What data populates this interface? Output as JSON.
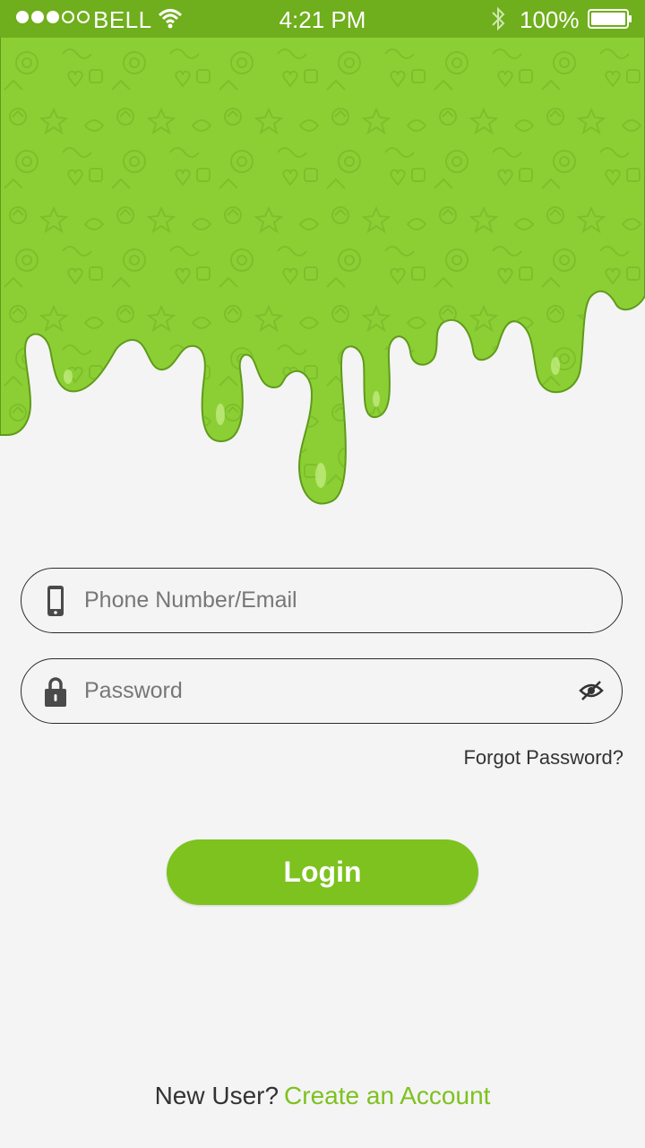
{
  "status_bar": {
    "carrier": "BELL",
    "time": "4:21 PM",
    "battery": "100%",
    "signal_bars_filled": 3,
    "signal_bars_total": 5
  },
  "header": {
    "illustration": "green-slime-doodle-pattern"
  },
  "form": {
    "phone_placeholder": "Phone Number/Email",
    "password_placeholder": "Password",
    "forgot_label": "Forgot Password?",
    "login_label": "Login"
  },
  "footer": {
    "prompt": "New User?",
    "link": "Create an Account"
  },
  "colors": {
    "accent": "#7dc21e",
    "slime": "#8ccf34",
    "status_bar": "#6fae1c",
    "background": "#f4f4f4"
  },
  "icons": [
    "phone-icon",
    "lock-icon",
    "eye-hide-icon",
    "wifi-icon",
    "bluetooth-icon",
    "battery-icon"
  ]
}
